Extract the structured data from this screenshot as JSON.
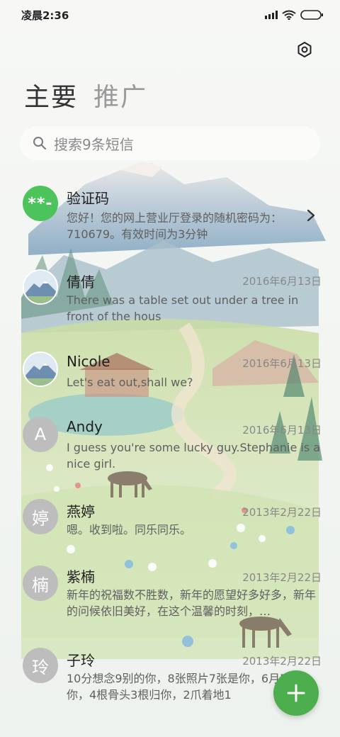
{
  "status_bar": {
    "time": "凌晨2:36"
  },
  "tabs": [
    {
      "label": "主要"
    },
    {
      "label": "推广"
    }
  ],
  "search": {
    "placeholder": "搜索9条短信"
  },
  "conversations": [
    {
      "name": "验证码",
      "date": "",
      "preview": "您好！您的网上营业厅登录的随机密码为：710679。有效时间为3分钟",
      "avatar_text": "**-",
      "avatar_style": "green"
    },
    {
      "name": "倩倩",
      "date": "2016年6月13日",
      "preview": "There was a table set out under a tree in front of the hous",
      "avatar_text": "",
      "avatar_style": "photo"
    },
    {
      "name": "Nicole",
      "date": "2016年6月13日",
      "preview": "Let's eat out,shall we?",
      "avatar_text": "",
      "avatar_style": "photo"
    },
    {
      "name": "Andy",
      "date": "2016年6月13日",
      "preview": "I guess you're some lucky guy.Stephanie is a nice girl.",
      "avatar_text": "A",
      "avatar_style": "gray"
    },
    {
      "name": "燕婷",
      "date": "2013年2月22日",
      "preview": "嗯。收到啦。同乐同乐。",
      "avatar_text": "婷",
      "avatar_style": "gray"
    },
    {
      "name": "紫楠",
      "date": "2013年2月22日",
      "preview": "新年的祝福数不胜数，新年的愿望好多好多，新年的问候依旧美好，在这个温馨的时刻，…",
      "avatar_text": "楠",
      "avatar_style": "gray"
    },
    {
      "name": "子玲",
      "date": "2013年2月22日",
      "preview": "10分想念9别的你，8张照片7张是你，6月5只像你，4根骨头3根归你，2爪着地1",
      "avatar_text": "玲",
      "avatar_style": "gray"
    }
  ],
  "colors": {
    "accent_green": "#4cae4c",
    "avatar_gray": "#bdbdbd"
  }
}
